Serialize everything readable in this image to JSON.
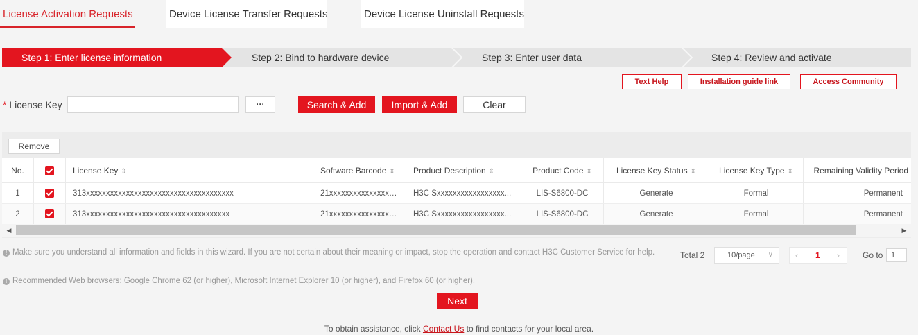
{
  "tabs": [
    {
      "label": "License Activation Requests",
      "active": true
    },
    {
      "label": "Device License Transfer Requests",
      "active": false
    },
    {
      "label": "Device License Uninstall Requests",
      "active": false
    }
  ],
  "steps": [
    {
      "label": "Step 1: Enter license information",
      "active": true
    },
    {
      "label": "Step 2: Bind to hardware device",
      "active": false
    },
    {
      "label": "Step 3: Enter user data",
      "active": false
    },
    {
      "label": "Step 4: Review and activate",
      "active": false
    }
  ],
  "help": {
    "text_help": "Text Help",
    "install_guide": "Installation guide link",
    "community": "Access Community"
  },
  "form": {
    "required_mark": "*",
    "license_key_label": "License Key",
    "license_key_value": "",
    "dots": "···",
    "search_add": "Search & Add",
    "import_add": "Import & Add",
    "clear": "Clear"
  },
  "table": {
    "remove_label": "Remove",
    "columns": [
      "No.",
      "",
      "License Key",
      "Software Barcode",
      "Product Description",
      "Product Code",
      "License Key Status",
      "License Key Type",
      "Remaining Validity Period"
    ],
    "rows": [
      {
        "no": "1",
        "checked": true,
        "license_key": "313xxxxxxxxxxxxxxxxxxxxxxxxxxxxxxxxxxxxx",
        "barcode": "21xxxxxxxxxxxxxxxxx...",
        "description": "H3C Sxxxxxxxxxxxxxxxxx...",
        "code": "LIS-S6800-DC",
        "status": "Generate",
        "type": "Formal",
        "validity": "Permanent"
      },
      {
        "no": "2",
        "checked": true,
        "license_key": "313xxxxxxxxxxxxxxxxxxxxxxxxxxxxxxxxxxxx",
        "barcode": "21xxxxxxxxxxxxxxxxx...",
        "description": "H3C Sxxxxxxxxxxxxxxxxx...",
        "code": "LIS-S6800-DC",
        "status": "Generate",
        "type": "Formal",
        "validity": "Permanent"
      }
    ]
  },
  "notes": {
    "note1": "Make sure you understand all information and fields in this wizard. If you are not certain about their meaning or impact, stop the operation and contact H3C Customer Service for help.",
    "note2": "Recommended Web browsers: Google Chrome 62 (or higher), Microsoft Internet Explorer 10 (or higher), and Firefox 60 (or higher)."
  },
  "pagination": {
    "total": "Total 2",
    "page_size": "10/page",
    "current_page": "1",
    "goto_label": "Go to",
    "goto_value": "1"
  },
  "next_label": "Next",
  "footer": {
    "prefix": "To obtain assistance, click ",
    "link": "Contact Us",
    "suffix": " to find contacts for your local area."
  },
  "colors": {
    "accent": "#e3151f",
    "accent_text": "#d8232a"
  }
}
